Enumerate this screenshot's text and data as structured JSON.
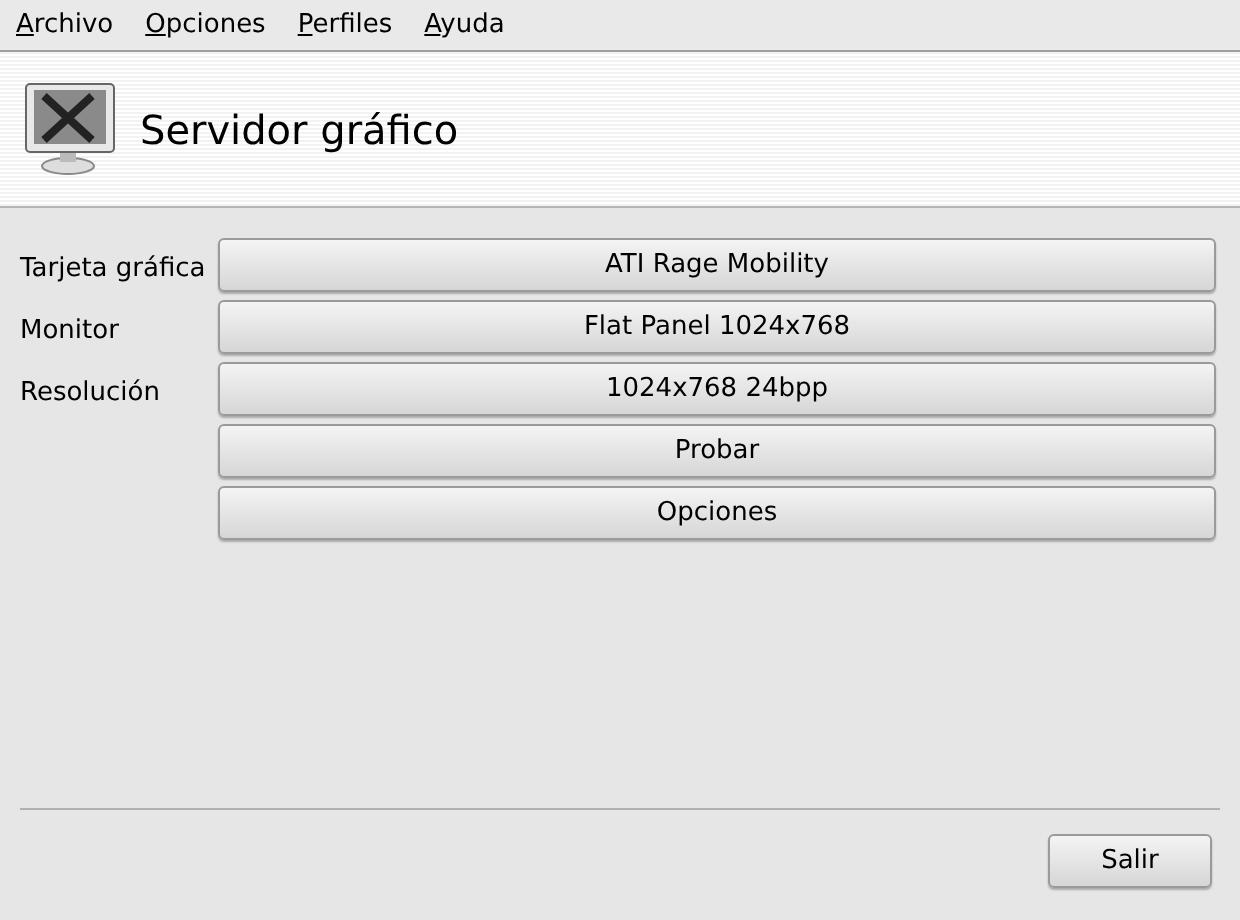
{
  "menu": [
    {
      "mnemonic": "A",
      "rest": "rchivo"
    },
    {
      "mnemonic": "O",
      "rest": "pciones"
    },
    {
      "mnemonic": "P",
      "rest": "erfiles"
    },
    {
      "mnemonic": "A",
      "rest": "yuda"
    }
  ],
  "header": {
    "title": "Servidor gráfico"
  },
  "rows": [
    {
      "label": "Tarjeta gráfica",
      "button": "ATI Rage Mobility"
    },
    {
      "label": "Monitor",
      "button": "Flat Panel 1024x768"
    },
    {
      "label": "Resolución",
      "button": "1024x768 24bpp"
    },
    {
      "button": "Probar"
    },
    {
      "button": "Opciones"
    }
  ],
  "footer": {
    "button": "Salir"
  }
}
